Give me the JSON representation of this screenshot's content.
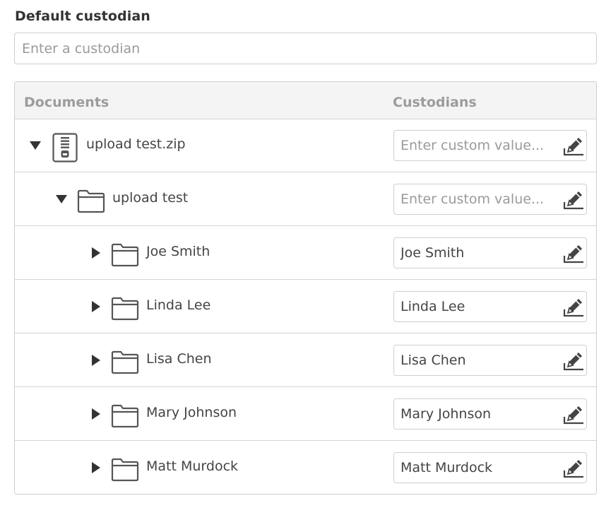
{
  "default_custodian": {
    "label": "Default custodian",
    "placeholder": "Enter a custodian",
    "value": ""
  },
  "table": {
    "headers": {
      "documents": "Documents",
      "custodians": "Custodians"
    },
    "custom_value_placeholder": "Enter custom value...",
    "rows": [
      {
        "name": "upload test.zip",
        "type": "zip-file",
        "expanded": true,
        "level": 0,
        "custodian": ""
      },
      {
        "name": "upload test",
        "type": "folder",
        "expanded": true,
        "level": 1,
        "custodian": ""
      },
      {
        "name": "Joe Smith",
        "type": "folder",
        "expanded": false,
        "level": 2,
        "custodian": "Joe Smith"
      },
      {
        "name": "Linda Lee",
        "type": "folder",
        "expanded": false,
        "level": 2,
        "custodian": "Linda Lee"
      },
      {
        "name": "Lisa Chen",
        "type": "folder",
        "expanded": false,
        "level": 2,
        "custodian": "Lisa Chen"
      },
      {
        "name": "Mary Johnson",
        "type": "folder",
        "expanded": false,
        "level": 2,
        "custodian": "Mary Johnson"
      },
      {
        "name": "Matt Murdock",
        "type": "folder",
        "expanded": false,
        "level": 2,
        "custodian": "Matt Murdock"
      }
    ]
  },
  "icons": {
    "expanded_toggle": "caret-down-icon",
    "collapsed_toggle": "caret-right-icon",
    "zip_file": "zip-file-icon",
    "folder": "folder-icon",
    "edit": "edit-pencil-icon"
  }
}
